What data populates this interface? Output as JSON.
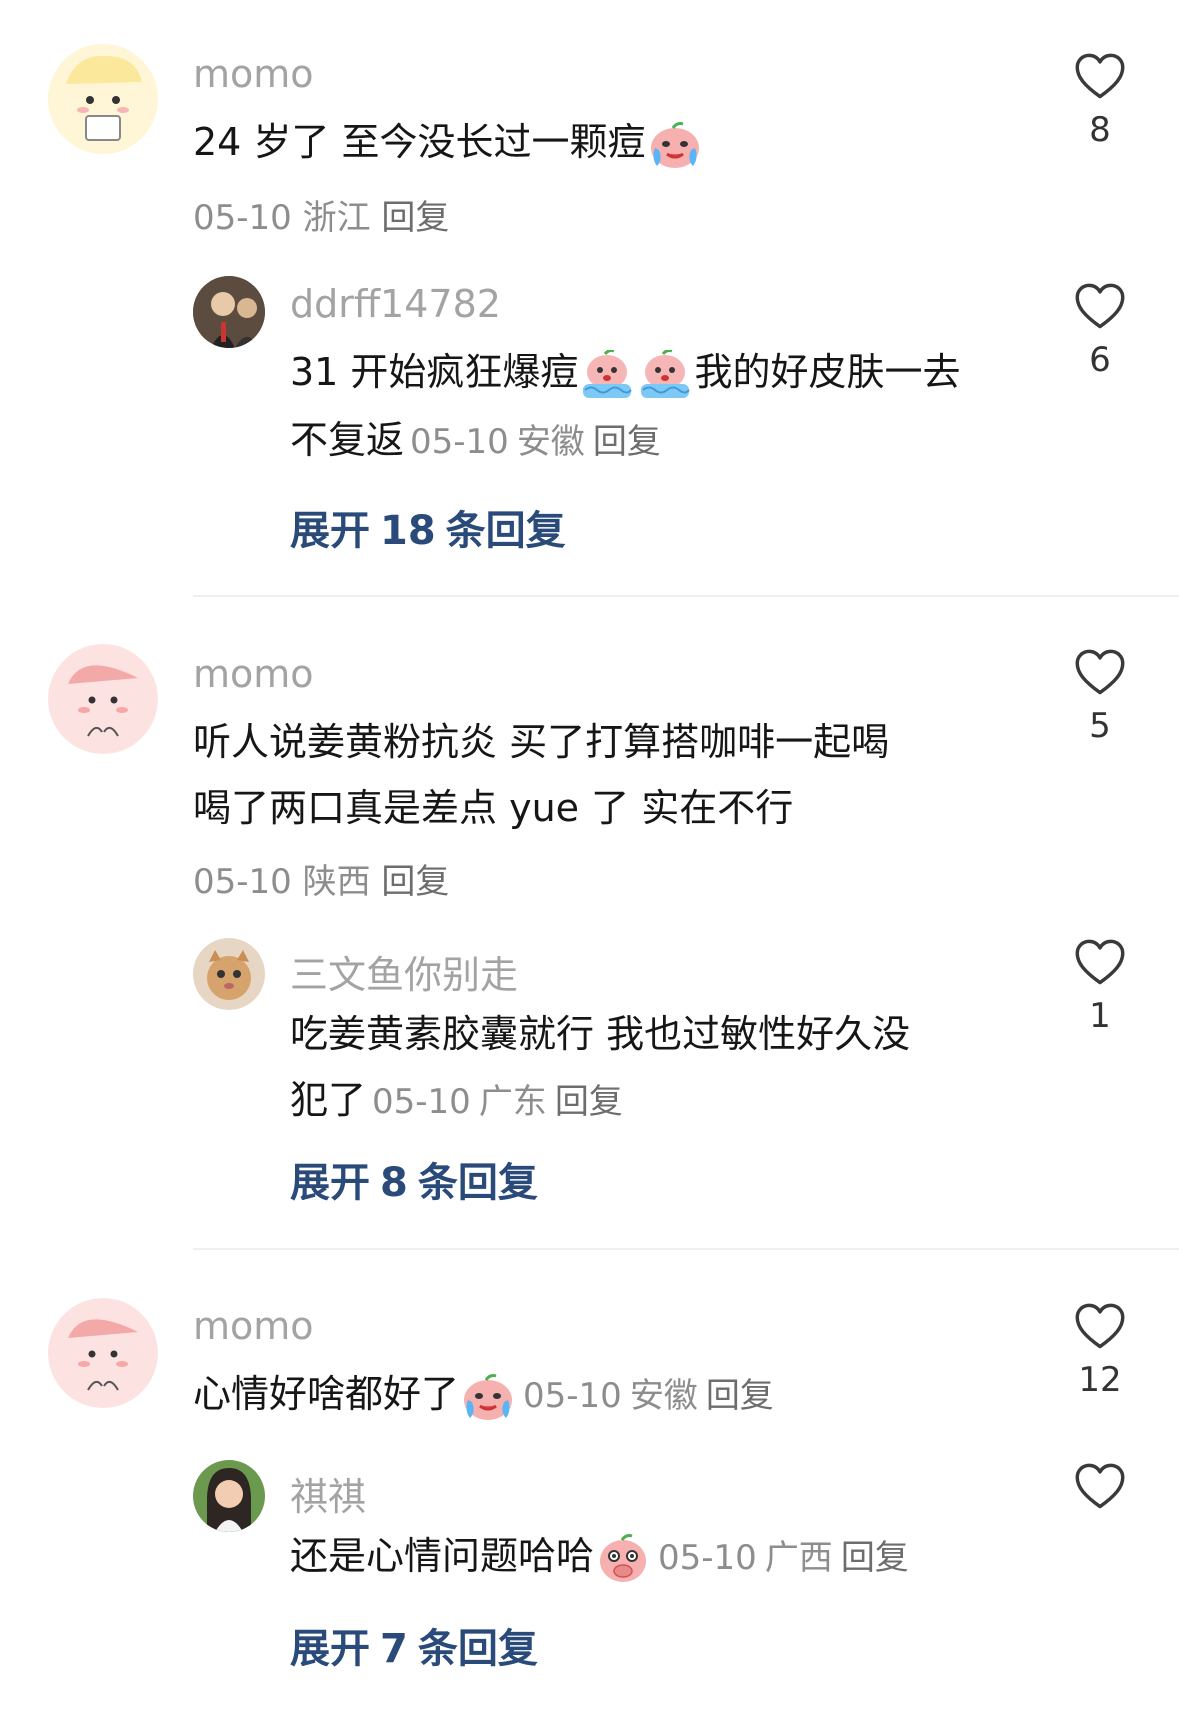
{
  "comments": [
    {
      "user": "momo",
      "text": "24 岁了 至今没长过一颗痘",
      "date": "05-10",
      "location": "浙江",
      "reply_label": "回复",
      "likes": "8",
      "reply": {
        "user": "ddrff14782",
        "text_line1_a": "31 开始疯狂爆痘",
        "text_line1_b": "我的好皮肤一去",
        "text_line2": "不复返",
        "date": "05-10",
        "location": "安徽",
        "reply_label": "回复",
        "likes": "6"
      },
      "expand": {
        "prefix": "展开",
        "count": "18",
        "suffix": "条回复"
      }
    },
    {
      "user": "momo",
      "text_line1": "听人说姜黄粉抗炎 买了打算搭咖啡一起喝",
      "text_line2": "喝了两口真是差点 yue 了 实在不行",
      "date": "05-10",
      "location": "陕西",
      "reply_label": "回复",
      "likes": "5",
      "reply": {
        "user": "三文鱼你别走",
        "text_line1": "吃姜黄素胶囊就行   我也过敏性好久没",
        "text_line2": "犯了",
        "date": "05-10",
        "location": "广东",
        "reply_label": "回复",
        "likes": "1"
      },
      "expand": {
        "prefix": "展开",
        "count": "8",
        "suffix": "条回复"
      }
    },
    {
      "user": "momo",
      "text": "心情好啥都好了",
      "date": "05-10",
      "location": "安徽",
      "reply_label": "回复",
      "likes": "12",
      "reply": {
        "user": "祺祺",
        "text": "还是心情问题哈哈",
        "date": "05-10",
        "location": "广西",
        "reply_label": "回复",
        "likes": ""
      },
      "expand": {
        "prefix": "展开",
        "count": "7",
        "suffix": "条回复"
      }
    }
  ],
  "colors": {
    "username": "#a3a3a3",
    "meta": "#8d8d8d",
    "expand": "#2a4a7a",
    "divider": "#efefef"
  },
  "icons": {
    "like": "heart-outline-icon",
    "emoji_cry": "crying-peach-emoji",
    "emoji_wave": "crying-in-water-emoji",
    "emoji_cover": "covering-mouth-emoji"
  }
}
